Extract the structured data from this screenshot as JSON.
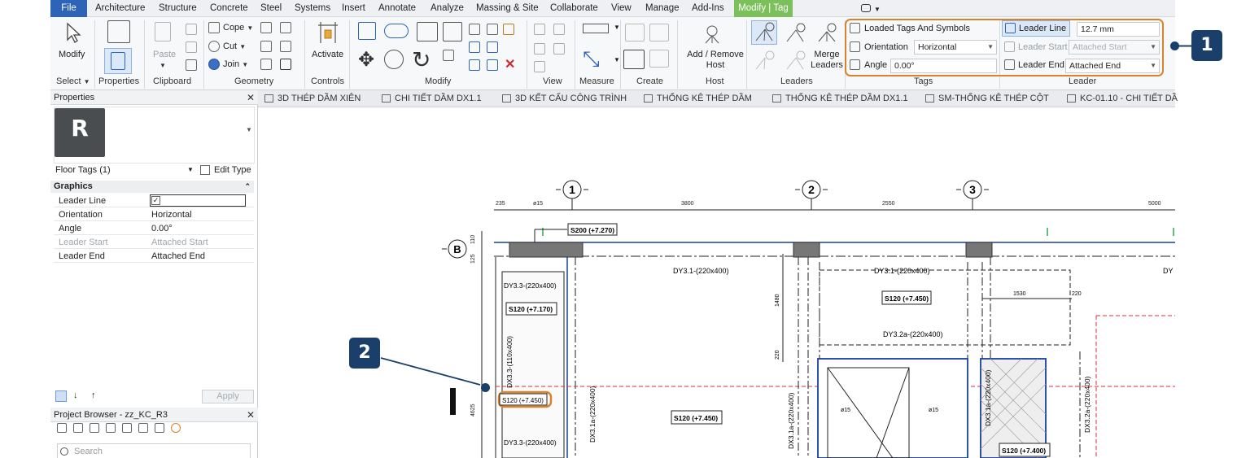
{
  "menubar": {
    "tabs": [
      "File",
      "Architecture",
      "Structure",
      "Concrete",
      "Steel",
      "Systems",
      "Insert",
      "Annotate",
      "Analyze",
      "Massing & Site",
      "Collaborate",
      "View",
      "Manage",
      "Add-Ins",
      "Modify | Tag"
    ],
    "active_tab": "Modify | Tag"
  },
  "ribbon": {
    "select": {
      "title": "Select",
      "modify_label": "Modify"
    },
    "properties": {
      "title": "Properties",
      "label": "Properties"
    },
    "clipboard": {
      "title": "Clipboard",
      "paste_label": "Paste"
    },
    "geometry": {
      "title": "Geometry",
      "cope_label": "Cope",
      "cut_label": "Cut",
      "join_label": "Join"
    },
    "controls": {
      "title": "Controls",
      "activate_label": "Activate"
    },
    "modify": {
      "title": "Modify"
    },
    "view": {
      "title": "View"
    },
    "measure": {
      "title": "Measure"
    },
    "create": {
      "title": "Create"
    },
    "host": {
      "title": "Host",
      "add_remove_line1": "Add / Remove",
      "add_remove_line2": "Host"
    },
    "leaders": {
      "title": "Leaders",
      "merge_line1": "Merge",
      "merge_line2": "Leaders"
    },
    "tags": {
      "title": "Tags",
      "loaded_tags_label": "Loaded Tags And Symbols",
      "orientation_label": "Orientation",
      "orientation_value": "Horizontal",
      "angle_label": "Angle",
      "angle_value": "0.00°"
    },
    "leader": {
      "title": "Leader",
      "leader_line_label": "Leader Line",
      "leader_line_value": "12.7 mm",
      "leader_start_label": "Leader Start",
      "leader_start_value": "Attached Start",
      "leader_end_label": "Leader End",
      "leader_end_value": "Attached End"
    }
  },
  "callouts": {
    "one": "1",
    "two": "2"
  },
  "properties_panel": {
    "header": "Properties",
    "type_logo": "R",
    "filter_label": "Floor Tags (1)",
    "edit_type_label": "Edit Type",
    "group": "Graphics",
    "rows": [
      {
        "key": "Leader Line",
        "value": "✓",
        "dim": false
      },
      {
        "key": "Orientation",
        "value": "Horizontal",
        "dim": false
      },
      {
        "key": "Angle",
        "value": "0.00°",
        "dim": false
      },
      {
        "key": "Leader Start",
        "value": "Attached Start",
        "dim": true
      },
      {
        "key": "Leader End",
        "value": "Attached End",
        "dim": false
      }
    ],
    "apply_label": "Apply"
  },
  "project_browser": {
    "header": "Project Browser - zz_KC_R3",
    "search_placeholder": "Search"
  },
  "view_tabs": [
    "3D THÉP DẦM XIÊN",
    "CHI TIẾT DẦM DX1.1",
    "3D KẾT CẤU CÔNG TRÌNH",
    "THỐNG KÊ THÉP DẦM",
    "THỐNG KÊ THÉP DẦM DX1.1",
    "SM-THỐNG KÊ THÉP CỘT",
    "KC-01.10 - CHI TIẾT DẦ"
  ],
  "drawing": {
    "grid_labels": [
      "1",
      "2",
      "3"
    ],
    "row_label": "B",
    "dimensions": {
      "d235": "235",
      "d15": "ø15",
      "d3800": "3800",
      "d2550": "2550",
      "d5000": "5000",
      "d110": "110",
      "d125": "125",
      "d1480": "1480",
      "d220": "220",
      "d1530": "1530",
      "d220b": "220",
      "d4625": "4625",
      "d15b": "ø15",
      "d15c": "ø15"
    },
    "tags": {
      "s200": "S200 (+7.270)",
      "s120a": "S120 (+7.170)",
      "s120b": "S120 (+7.450)",
      "s120c": "S120 (+7.450)",
      "s120d": "S120 (+7.450)",
      "s120e": "S120 (+7.400)"
    },
    "beams": {
      "dy33a": "DY3.3-(220x400)",
      "dy33b": "DY3.3-(220x400)",
      "dx33": "DX3.3-(110x400)",
      "dy31a": "DY3.1-(220x400)",
      "dy31b": "DY3.1-(220x400)",
      "dy32a": "DY3.2a-(220x400)",
      "dx31a": "DX3.1a-(220x400)",
      "dx31b": "DX3.1a-(220x400)",
      "dx31c": "DX3.1a-(220x400)",
      "dx32a": "DX3.2a-(220x400)",
      "dy_cut": "DY"
    }
  }
}
